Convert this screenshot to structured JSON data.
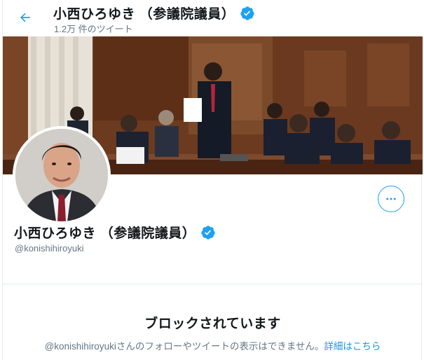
{
  "header": {
    "title": "小西ひろゆき （参議院議員）",
    "tweet_count": "1.2万 件のツイート",
    "back_icon": "arrow-left-icon"
  },
  "profile": {
    "display_name": "小西ひろゆき （参議院議員）",
    "handle": "@konishihiroyuki",
    "verified_icon": "verified-badge-icon",
    "more_icon": "more-dots-icon"
  },
  "blocked": {
    "title": "ブロックされています",
    "message": "@konishihiroyukiさんのフォローやツイートの表示はできません。",
    "learn_more": "詳細はこちら"
  },
  "colors": {
    "accent": "#1da1f2",
    "link": "#1b95e0",
    "muted": "#657786",
    "text": "#14171a"
  }
}
